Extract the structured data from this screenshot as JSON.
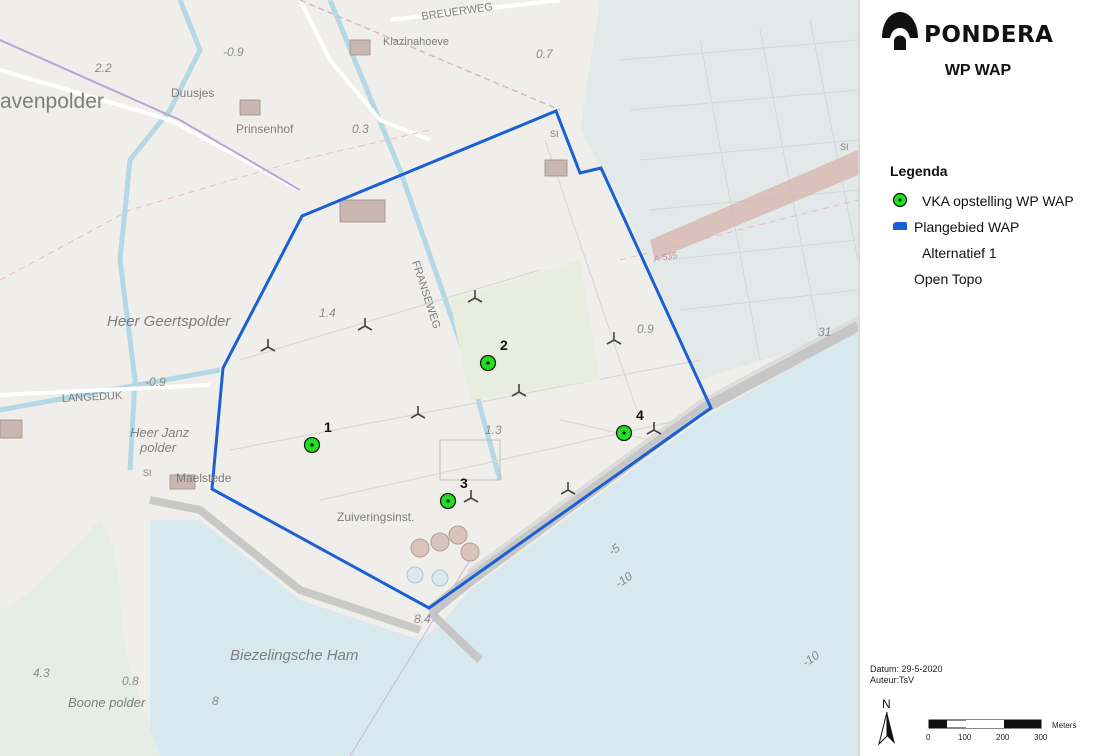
{
  "header": {
    "brand": "PONDERA",
    "title": "WP WAP"
  },
  "legend": {
    "title": "Legenda",
    "items": [
      {
        "label": "VKA opstelling WP WAP",
        "symbol": "green-dot",
        "color": "#22dd22"
      },
      {
        "label": "Plangebied WAP",
        "symbol": "blue-polygon",
        "color": "#1a5fd6"
      },
      {
        "label": "Alternatief 1",
        "symbol": "none"
      },
      {
        "label": "Open Topo",
        "symbol": "none"
      }
    ]
  },
  "meta": {
    "datum": "Datum: 29-5-2020",
    "auteur": "Auteur:TsV"
  },
  "north": "N",
  "scale": {
    "ticks": [
      "0",
      "100",
      "200",
      "300"
    ],
    "unit": "Meters"
  },
  "map": {
    "turbines": [
      {
        "id": "1"
      },
      {
        "id": "2"
      },
      {
        "id": "3"
      },
      {
        "id": "4"
      }
    ],
    "place_labels": {
      "vaver": "avenpolder",
      "duusjes": "Duusjes",
      "prinsenhof": "Prinsenhof",
      "klazinahoeve": "Klazinahoeve",
      "breuerweg": "BREUERWEG",
      "heer_geerts": "Heer Geertspolder",
      "langeduk": "LANGEDUK",
      "heer_janz_1": "Heer Janz",
      "heer_janz_2": "polder",
      "maelstede": "Maelstede",
      "si_1": "SI",
      "si_2": "SI",
      "si_3": "SI",
      "franseweg": "FRANSEWEG",
      "zuiverings": "Zuiveringsinst.",
      "bieze": "Biezelingsche Ham",
      "boone": "Boone polder",
      "a535": "A-535"
    },
    "heights": {
      "h1": "-0.9",
      "h2": "2.2",
      "h3": "0.7",
      "h4": "0.3",
      "h5": "1.4",
      "h6": "0.9",
      "h7": "1.3",
      "h8": "-0.9",
      "h9": "8.4",
      "h10": "4.3",
      "h11": "0.8",
      "h12": "8",
      "h13": "31",
      "h14": "-5",
      "h15": "-10",
      "h16": "-10"
    }
  },
  "colors": {
    "land": "#efeeea",
    "water": "#d8e9ef",
    "boundary": "#1a5fd6",
    "turbine_dot": "#22dd22",
    "canal": "#b4d8e6"
  }
}
